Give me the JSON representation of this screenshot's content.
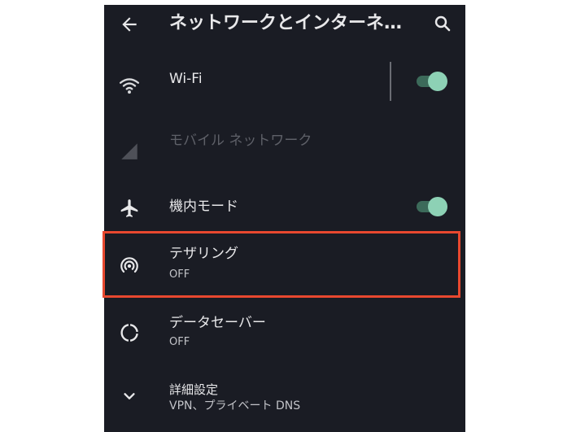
{
  "header": {
    "title": "ネットワークとインターネ…",
    "back_icon": "back-arrow-icon",
    "search_icon": "search-icon"
  },
  "settings": [
    {
      "title": "Wi-Fi",
      "icon": "wifi-icon",
      "toggle": true
    },
    {
      "title": "モバイル ネットワーク",
      "icon": "cellular-signal-icon",
      "disabled": true
    },
    {
      "title": "機内モード",
      "icon": "airplane-icon",
      "toggle": true
    },
    {
      "title": "テザリング",
      "subtitle": "OFF",
      "icon": "hotspot-icon",
      "highlighted": true
    },
    {
      "title": "データセーバー",
      "subtitle": "OFF",
      "icon": "data-saver-icon"
    },
    {
      "title": "詳細設定",
      "subtitle": "VPN、プライベート DNS",
      "icon": "chevron-down-icon"
    }
  ],
  "colors": {
    "background": "#1a1c24",
    "text": "#e8e8ea",
    "toggle_on": "#8dd1b5",
    "highlight": "#e8482f"
  }
}
